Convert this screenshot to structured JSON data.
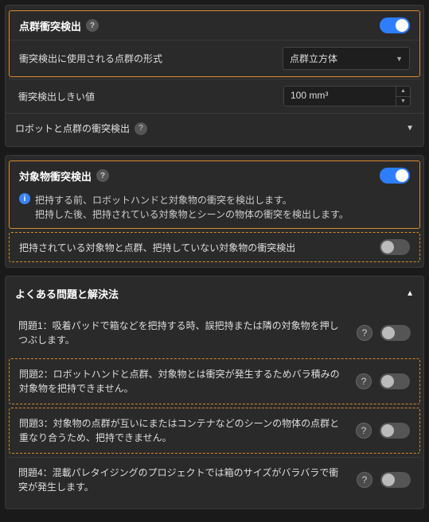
{
  "panel1": {
    "title": "点群衝突検出",
    "enabled": true,
    "row1": {
      "label": "衝突検出に使用される点群の形式",
      "value": "点群立方体"
    },
    "row2": {
      "label": "衝突検出しきい値",
      "value": "100 mm³"
    },
    "sub1": {
      "label": "ロボットと点群の衝突検出"
    }
  },
  "panel2": {
    "title": "対象物衝突検出",
    "enabled": true,
    "info_line1": "把持する前、ロボットハンドと対象物の衝突を検出します。",
    "info_line2": "把持した後、把持されている対象物とシーンの物体の衝突を検出します。",
    "row1": {
      "label": "把持されている対象物と点群、把持していない対象物の衝突検出",
      "enabled": false
    }
  },
  "panel3": {
    "title": "よくある問題と解決法",
    "items": [
      {
        "text": "問題1：吸着パッドで箱などを把持する時、誤把持または隣の対象物を押しつぶします。",
        "enabled": false,
        "dashed": false
      },
      {
        "text": "問題2：ロボットハンドと点群、対象物とは衝突が発生するためバラ積みの対象物を把持できません。",
        "enabled": false,
        "dashed": true
      },
      {
        "text": "問題3：対象物の点群が互いにまたはコンテナなどのシーンの物体の点群と重なり合うため、把持できません。",
        "enabled": false,
        "dashed": true
      },
      {
        "text": "問題4：混載パレタイジングのプロジェクトでは箱のサイズがバラバラで衝突が発生します。",
        "enabled": false,
        "dashed": false
      }
    ]
  }
}
